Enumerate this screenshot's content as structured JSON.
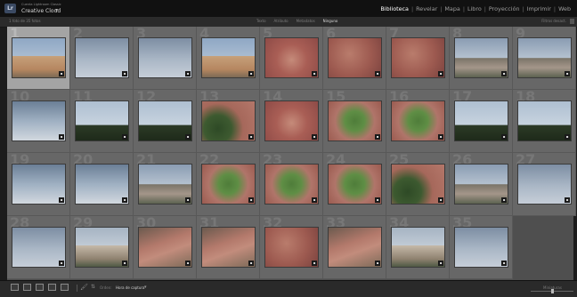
{
  "topbar": {
    "user_line": "Cuenta Lightroom Classic",
    "catalog": "Creative Cloud",
    "modules": [
      {
        "label": "Biblioteca",
        "active": true
      },
      {
        "label": "Revelar",
        "active": false
      },
      {
        "label": "Mapa",
        "active": false
      },
      {
        "label": "Libro",
        "active": false
      },
      {
        "label": "Proyección",
        "active": false
      },
      {
        "label": "Imprimir",
        "active": false
      },
      {
        "label": "Web",
        "active": false
      }
    ]
  },
  "filterbar": {
    "photo_count": "1 foto de 35 fotos",
    "filters": [
      {
        "label": "Texto",
        "active": false
      },
      {
        "label": "Atributo",
        "active": false
      },
      {
        "label": "Metadatos",
        "active": false
      },
      {
        "label": "Ninguno",
        "active": true
      }
    ],
    "filter_state": "Filtros desact."
  },
  "grid": {
    "columns": 9,
    "cells": [
      {
        "num": "1",
        "thumb": "church",
        "selected": true
      },
      {
        "num": "2",
        "thumb": "sky"
      },
      {
        "num": "3",
        "thumb": "sky"
      },
      {
        "num": "4",
        "thumb": "church"
      },
      {
        "num": "5",
        "thumb": "plaza"
      },
      {
        "num": "6",
        "thumb": "plaza2"
      },
      {
        "num": "7",
        "thumb": "plaza2"
      },
      {
        "num": "8",
        "thumb": "town"
      },
      {
        "num": "9",
        "thumb": "town"
      },
      {
        "num": "10",
        "thumb": "sky2"
      },
      {
        "num": "11",
        "thumb": "treesky"
      },
      {
        "num": "12",
        "thumb": "treesky"
      },
      {
        "num": "13",
        "thumb": "trees"
      },
      {
        "num": "14",
        "thumb": "plaza"
      },
      {
        "num": "15",
        "thumb": "park"
      },
      {
        "num": "16",
        "thumb": "park"
      },
      {
        "num": "17",
        "thumb": "treesky"
      },
      {
        "num": "18",
        "thumb": "treesky"
      },
      {
        "num": "19",
        "thumb": "sky2"
      },
      {
        "num": "20",
        "thumb": "sky2"
      },
      {
        "num": "21",
        "thumb": "town"
      },
      {
        "num": "22",
        "thumb": "park"
      },
      {
        "num": "23",
        "thumb": "park"
      },
      {
        "num": "24",
        "thumb": "park"
      },
      {
        "num": "25",
        "thumb": "trees"
      },
      {
        "num": "26",
        "thumb": "town"
      },
      {
        "num": "27",
        "thumb": "sky"
      },
      {
        "num": "28",
        "thumb": "sky"
      },
      {
        "num": "29",
        "thumb": "city"
      },
      {
        "num": "30",
        "thumb": "aerial"
      },
      {
        "num": "31",
        "thumb": "aerial"
      },
      {
        "num": "32",
        "thumb": "plaza2"
      },
      {
        "num": "33",
        "thumb": "aerial"
      },
      {
        "num": "34",
        "thumb": "city"
      },
      {
        "num": "35",
        "thumb": "sky"
      }
    ]
  },
  "toolbar": {
    "sort_label": "Orden:",
    "sort_value": "Hora de captura",
    "thumbnails_label": "Miniaturas"
  },
  "icons": {
    "lr_badge": "Lr",
    "badge_glyph": "▪",
    "chevron_down": "▾",
    "spray_can": "🖌",
    "sort_arrows": "⇅"
  }
}
